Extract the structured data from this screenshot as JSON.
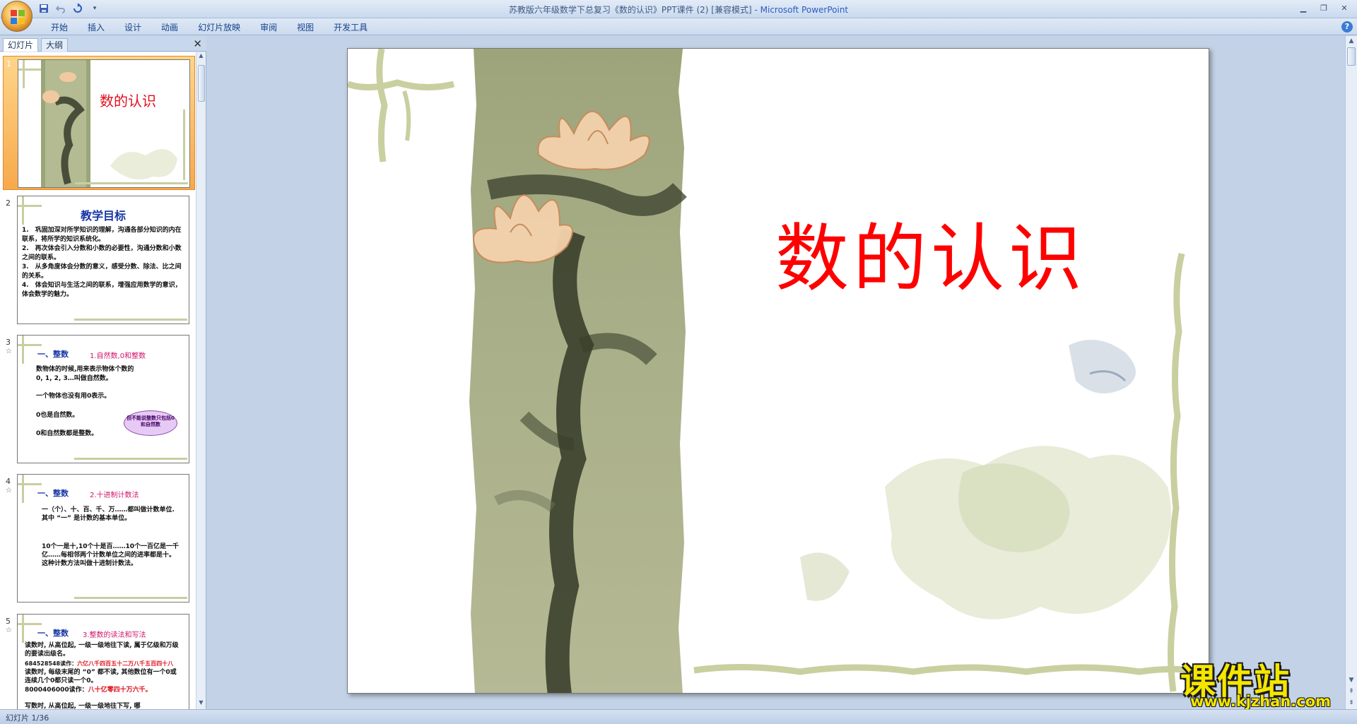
{
  "window": {
    "title": "苏教版六年级数学下总复习《数的认识》PPT课件 (2) [兼容模式] - ",
    "app_name": "Microsoft PowerPoint"
  },
  "ribbon": {
    "tabs": [
      "开始",
      "插入",
      "设计",
      "动画",
      "幻灯片放映",
      "审阅",
      "视图",
      "开发工具"
    ]
  },
  "panel": {
    "tab_slides": "幻灯片",
    "tab_outline": "大纲",
    "close": "✕"
  },
  "thumbnails": {
    "s1": {
      "num": "1",
      "title": "数的认识"
    },
    "s2": {
      "num": "2",
      "title": "教学目标",
      "lines": [
        "1.　巩固加深对所学知识的理解，沟通各部分知识的内在联系，将所学的知识系统化。",
        "2.　再次体会引入分数和小数的必要性，沟通分数和小数之间的联系。",
        "3.　从多角度体会分数的意义，感受分数、除法、比之间的关系。",
        "4.　体会知识与生活之间的联系，增强应用数学的意识，体会数学的魅力。"
      ]
    },
    "s3": {
      "num": "3",
      "head": "一、整数",
      "sub": "1.自然数,0和整数",
      "l1": "数物体的时候,用来表示物体个数的",
      "l2": "0, 1, 2, 3…叫做自然数。",
      "l3": "一个物体也没有用0表示。",
      "l4": "0也是自然数。",
      "l5": "0和自然数都是整数。",
      "bubble": "但不能说整数只包括0和自然数"
    },
    "s4": {
      "num": "4",
      "head": "一、整数",
      "sub": "2.十进制计数法",
      "p1": "一（个）、十、百、千、万……都叫做计数单位. 其中 “一” 是计数的基本单位。",
      "p2": "10个一是十,10个十是百……10个一百亿是一千亿……每相邻两个计数单位之间的进率都是十。这种计数方法叫做十进制计数法。"
    },
    "s5": {
      "num": "5",
      "head": "一、整数",
      "sub": "3.整数的读法和写法",
      "p1": "读数时, 从高位起, 一级一级地往下读, 属于亿级和万级的要读出级名。",
      "ex1_a": "684528548读作：",
      "ex1_b": "六亿八千四百五十二万八千五百四十八",
      "p2": "读数时, 每级末尾的 “0” 都不读, 其他数位有一个0或连续几个0都只读一个0。",
      "ex2_a": "8000406000读作：",
      "ex2_b": "八十亿零四十万六千。",
      "p3": "写数时, 从高位起, 一级一级地往下写, 哪"
    }
  },
  "slide": {
    "title": "数的认识"
  },
  "watermark": {
    "text": "课件站",
    "url": "www.kjzhan.com"
  },
  "statusbar": {
    "text": "幻灯片 1/36"
  },
  "colors": {
    "title_red": "#ff0000",
    "thumb_title_blue": "#1836a5",
    "accent_pink": "#d0146c",
    "selection_orange": "#f7a94b"
  }
}
